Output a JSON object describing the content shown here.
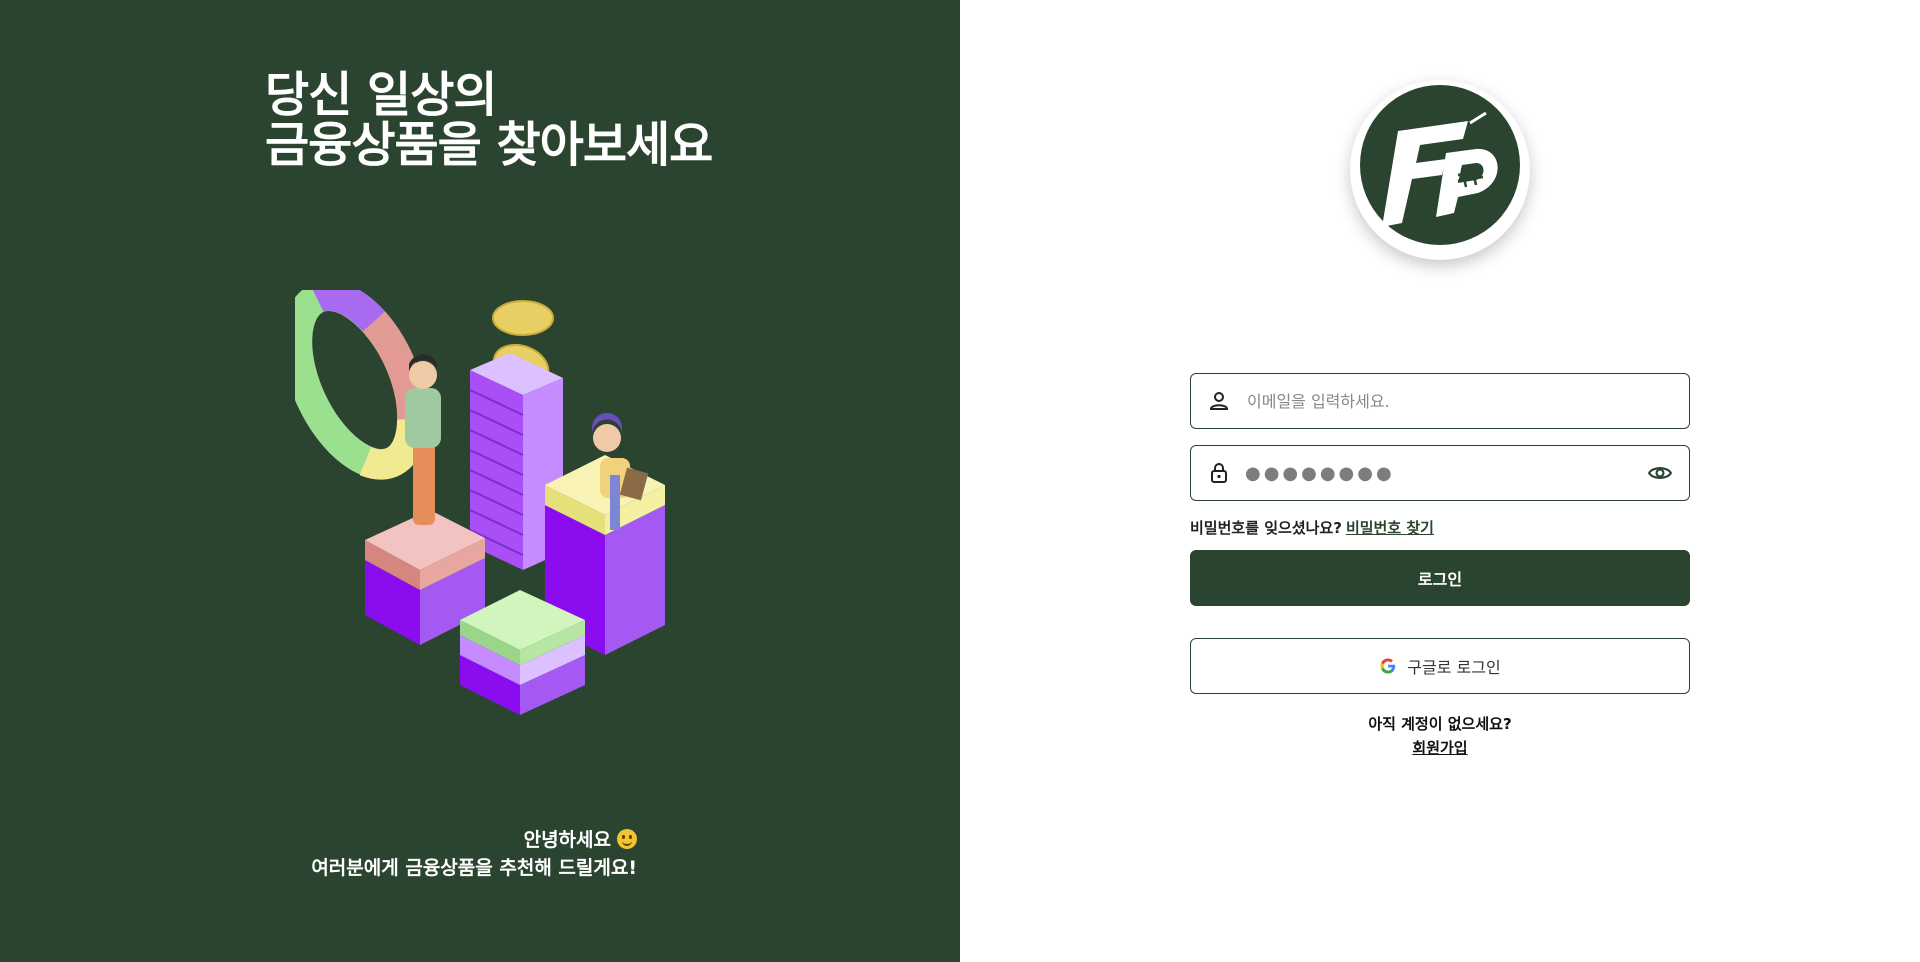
{
  "hero": {
    "title_line1": "당신 일상의",
    "title_line2": "금융상품을 찾아보세요",
    "greeting_line1": "안녕하세요",
    "greeting_line2": "여러분에게 금융상품을 추천해 드릴게요!"
  },
  "login": {
    "email_placeholder": "이메일을 입력하세요.",
    "password_masked": "●●●●●●●●",
    "forgot_prompt": "비밀번호를 잊으셨나요?",
    "forgot_link": "비밀번호 찾기",
    "login_button": "로그인",
    "google_button": "구글로 로그인",
    "no_account_prompt": "아직 계정이 없으세요?",
    "signup_link": "회원가입"
  },
  "colors": {
    "brand_green": "#2b4430",
    "white": "#ffffff"
  },
  "icons": {
    "email": "person-icon",
    "password": "lock-icon",
    "toggle": "eye-icon",
    "google": "google-icon",
    "logo": "fp-logo"
  }
}
